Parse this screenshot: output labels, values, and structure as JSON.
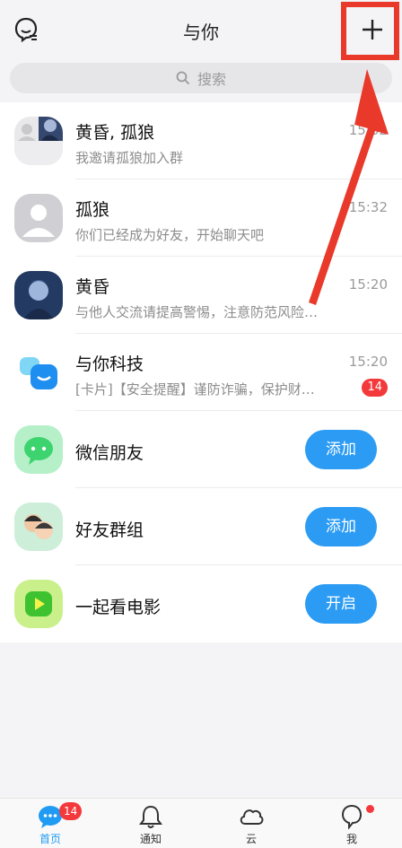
{
  "header": {
    "title": "与你",
    "profile_icon": "profile-icon",
    "add_icon": "plus-icon"
  },
  "search": {
    "placeholder": "搜索",
    "icon": "search-icon"
  },
  "conversations": [
    {
      "name": "黄昏, 孤狼",
      "message": "我邀请孤狼加入群",
      "time": "15:32"
    },
    {
      "name": "孤狼",
      "message": "你们已经成为好友，开始聊天吧",
      "time": "15:32"
    },
    {
      "name": "黄昏",
      "message": "与他人交流请提高警惕，注意防范风险…",
      "time": "15:20"
    },
    {
      "name": "与你科技",
      "message": "[卡片]【安全提醒】谨防诈骗，保护财…",
      "time": "15:20",
      "badge": "14"
    }
  ],
  "features": [
    {
      "name": "微信朋友",
      "button": "添加",
      "icon": "wechat-icon"
    },
    {
      "name": "好友群组",
      "button": "添加",
      "icon": "group-icon"
    },
    {
      "name": "一起看电影",
      "button": "开启",
      "icon": "play-icon"
    }
  ],
  "tabs": [
    {
      "label": "首页",
      "icon": "chat-bubble-icon",
      "badge": "14",
      "active": true
    },
    {
      "label": "通知",
      "icon": "bell-icon"
    },
    {
      "label": "云",
      "icon": "cloud-icon"
    },
    {
      "label": "我",
      "icon": "profile-icon",
      "dot": true
    }
  ],
  "colors": {
    "accent": "#2b9bf4",
    "badge": "#f4393c",
    "highlight": "#e8392a"
  }
}
